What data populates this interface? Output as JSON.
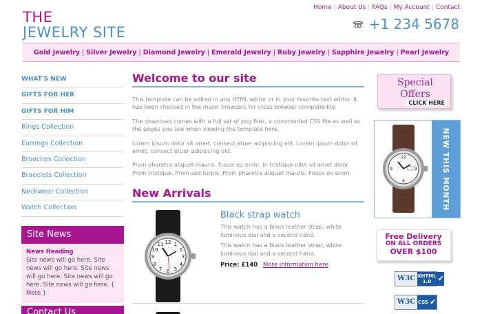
{
  "logo": {
    "line1": "The",
    "line2": "Jewelry Site"
  },
  "toplinks": [
    "Home",
    "About Us",
    "FAQs",
    "My Account",
    "Contact"
  ],
  "phone": "+1 234 5678",
  "categories": [
    "Gold Jewelry",
    "Silver Jewelry",
    "Diamond Jewelry",
    "Emerald Jewelry",
    "Ruby Jewelry",
    "Sapphire Jewelry",
    "Pearl Jewelry"
  ],
  "sidebar": {
    "items": [
      "WHAT'S NEW",
      "GIFTS FOR HER",
      "GIFTS FOR HIM",
      "Rings Collection",
      "Earrings Collection",
      "Brooches Collection",
      "Bracelets Collection",
      "Neckwear Collection",
      "Watch Collection"
    ]
  },
  "sitenews": {
    "title": "Site News",
    "heading": "News Heading",
    "text": "Site news will go here. Site news will go here. Site news will go here. Site news will go here. Site news will go here.",
    "more": "More"
  },
  "contact_title": "Contact Us",
  "welcome": {
    "title": "Welcome to our site",
    "p1": "This template can be edited in any HTML editor or in your favorite text editor. It has been checked in the major browsers for cross browser compatibility.",
    "p2": "The download comes with a full set of png files, a commented CSS file as well as the pages you see when viewing the template here.",
    "p3": "Lorem ipsum dolor sit amet, consect etuer adipiscing elit. Lorem ipsum dolor sit amet, consect etuer adipiscing elit.",
    "p4": "Proin pharetra aliquet mauris. Fusce eu enim. In tristique nibh sit amet dolor. Proin tristique. Proin sed turpis. Proin pharetra aliquet mauris. Fusce eu enim."
  },
  "arrivals": {
    "title": "New Arrivals",
    "product": {
      "name": "Black strap watch",
      "desc1": "This watch has a black leather strap, white luminous dial and a second hand.",
      "desc2": "This watch has a black leather strap, white luminous dial and a second hand.",
      "price": "Price: £140",
      "more": "More information here"
    }
  },
  "special": {
    "line1": "Special",
    "line2": "Offers",
    "click": "CLICK HERE"
  },
  "newmonth": "NEW THIS MONTH",
  "freedel": {
    "l1": "Free Delivery",
    "l2": "ON ALL ORDERS",
    "l3": "over $100"
  },
  "badges": [
    {
      "w3": "W3C",
      "label": "XHTML 1.0"
    },
    {
      "w3": "W3C",
      "label": "CSS"
    }
  ],
  "colors": {
    "accent": "#a8178f",
    "blue": "#4a8fd2",
    "pink": "#fce6f4"
  }
}
